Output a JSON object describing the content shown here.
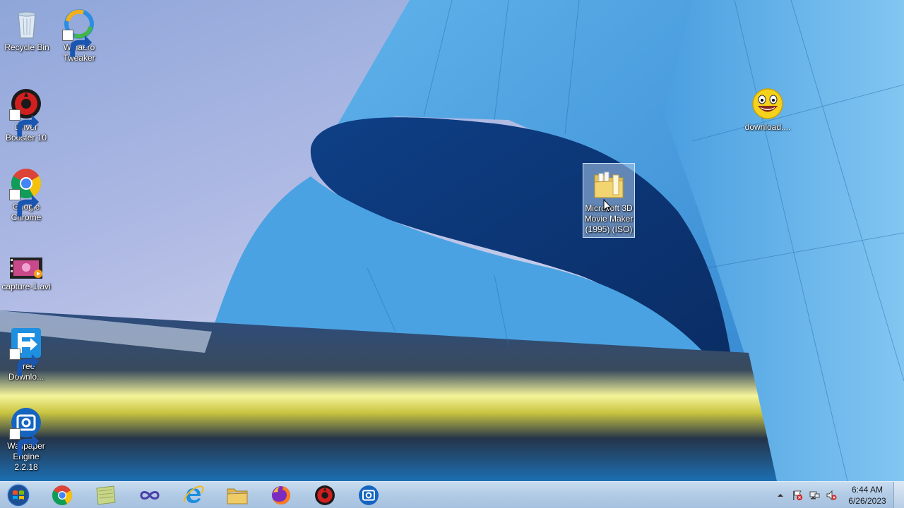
{
  "desktop": {
    "icons": [
      {
        "label": "Recycle Bin",
        "icon": "recycle-bin-icon"
      },
      {
        "label": "Winaero Tweaker",
        "icon": "winaero-tweaker-icon"
      },
      {
        "label": "Driver Booster 10",
        "icon": "driver-booster-icon"
      },
      {
        "label": "Google Chrome",
        "icon": "chrome-icon"
      },
      {
        "label": "capture-1.avi",
        "icon": "video-file-icon"
      },
      {
        "label": "Free Downlo...",
        "icon": "free-download-manager-icon"
      },
      {
        "label": "Wallpaper Engine 2.2.18",
        "icon": "wallpaper-engine-icon"
      },
      {
        "label": "download....",
        "icon": "smiley-image-icon"
      },
      {
        "label": "Microsoft 3D Movie Maker (1995) (ISO)",
        "icon": "folder-icon",
        "selected": true
      }
    ]
  },
  "taskbar": {
    "start": {
      "label": "Start",
      "icon": "windows-orb-icon"
    },
    "pinned": [
      {
        "name": "Google Chrome",
        "icon": "chrome-icon"
      },
      {
        "name": "Sticky Notes",
        "icon": "notes-icon"
      },
      {
        "name": "Winaero",
        "icon": "infinity-icon"
      },
      {
        "name": "Internet Explorer",
        "icon": "internet-explorer-icon"
      },
      {
        "name": "File Explorer",
        "icon": "file-explorer-icon"
      },
      {
        "name": "Firefox",
        "icon": "firefox-icon"
      },
      {
        "name": "Driver Booster",
        "icon": "driver-booster-icon"
      },
      {
        "name": "Wallpaper Engine",
        "icon": "wallpaper-engine-icon"
      }
    ],
    "tray": {
      "icons": [
        "chevron-up-icon",
        "action-center-flag-icon",
        "network-icon",
        "volume-muted-icon"
      ],
      "time": "6:44 AM",
      "date": "6/26/2023"
    }
  },
  "colors": {
    "taskbar": "#b3cce6",
    "sky": "#aeb9e4",
    "building": "#3d8fd6",
    "selection": "#aac8eb"
  }
}
